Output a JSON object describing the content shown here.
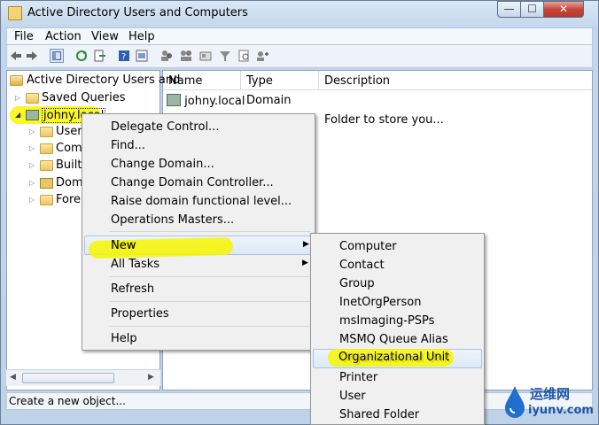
{
  "window": {
    "title": "Active Directory Users and Computers"
  },
  "title_buttons": {
    "minimize": "—",
    "maximize": "☐",
    "close": "✕"
  },
  "menubar": [
    "File",
    "Action",
    "View",
    "Help"
  ],
  "tree": {
    "root": "Active Directory Users and",
    "saved_queries": "Saved Queries",
    "domain": "johny.local",
    "children": [
      "Users",
      "Comp",
      "Builti",
      "Dom",
      "Forei"
    ]
  },
  "list": {
    "columns": [
      "Name",
      "Type",
      "Description"
    ],
    "rows": [
      {
        "name": "johny.local",
        "type": "Domain",
        "description": ""
      },
      {
        "name": "",
        "type": "",
        "description": "Folder to store you..."
      }
    ]
  },
  "context_menu": {
    "items": [
      "Delegate Control...",
      "Find...",
      "Change Domain...",
      "Change Domain Controller...",
      "Raise domain functional level...",
      "Operations Masters...",
      "New",
      "All Tasks",
      "Refresh",
      "Properties",
      "Help"
    ]
  },
  "submenu": {
    "items": [
      "Computer",
      "Contact",
      "Group",
      "InetOrgPerson",
      "msImaging-PSPs",
      "MSMQ Queue Alias",
      "Organizational Unit",
      "Printer",
      "User",
      "Shared Folder"
    ]
  },
  "status": "Create a new object...",
  "watermark": {
    "text1": "运维网",
    "text2": "iyunv.com"
  },
  "colors": {
    "highlight": "#fbf33d",
    "selection": "#dce8f7"
  }
}
